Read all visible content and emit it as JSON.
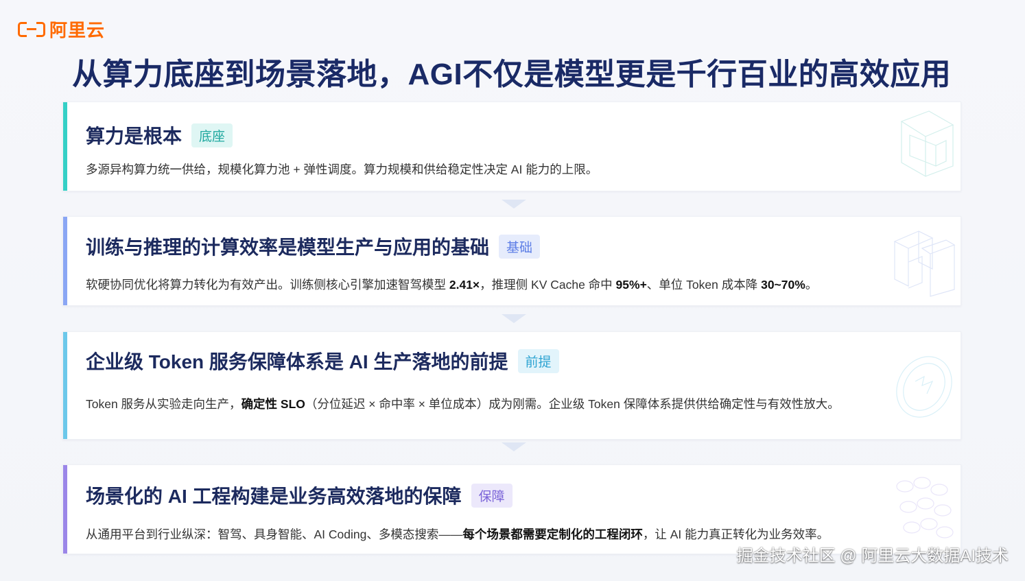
{
  "brand": {
    "logo_text": "阿里云"
  },
  "title": "从算力底座到场景落地，AGI不仅是模型更是千行百业的高效应用",
  "cards": [
    {
      "heading": "算力是根本",
      "tag": "底座",
      "accent": "#35d0c6",
      "tag_bg": "#dff6f4",
      "tag_color": "#1fa89f",
      "desc": "多源异构算力统一供给，规模化算力池 + 弹性调度。算力规模和供给稳定性决定 AI 能力的上限。"
    },
    {
      "heading": "训练与推理的计算效率是模型生产与应用的基础",
      "tag": "基础",
      "accent": "#8aa6f4",
      "tag_bg": "#e6ecfc",
      "tag_color": "#5d7ee6",
      "desc_parts": [
        "软硬协同优化将算力转化为有效产出。训练侧核心引擎加速智驾模型 ",
        "2.41×",
        "，推理侧 KV Cache 命中 ",
        "95%+",
        "、单位 Token 成本降 ",
        "30~70%",
        "。"
      ]
    },
    {
      "heading": "企业级 Token 服务保障体系是 AI 生产落地的前提",
      "tag": "前提",
      "accent": "#6cc8ea",
      "tag_bg": "#e2f4fb",
      "tag_color": "#2ea4d2",
      "desc_parts": [
        "Token 服务从实验走向生产，",
        "确定性 SLO",
        "（分位延迟 × 命中率 × 单位成本）成为刚需。企业级 Token 保障体系提供供给确定性与有效性放大。"
      ]
    },
    {
      "heading": "场景化的 AI 工程构建是业务高效落地的保障",
      "tag": "保障",
      "accent": "#9b86e8",
      "tag_bg": "#ece8fb",
      "tag_color": "#7b64d8",
      "desc_parts": [
        "从通用平台到行业纵深：智驾、具身智能、AI Coding、多模态搜索——",
        "每个场景都需要定制化的工程闭环",
        "，让 AI 能力真正转化为业务效率。"
      ]
    }
  ],
  "watermark": "掘金技术社区 @ 阿里云大数据AI技术"
}
